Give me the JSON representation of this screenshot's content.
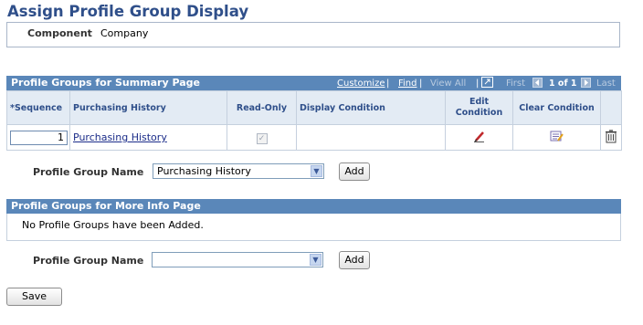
{
  "page": {
    "title": "Assign Profile Group Display"
  },
  "component": {
    "label": "Component",
    "value": "Company"
  },
  "summary_grid": {
    "title": "Profile Groups for Summary Page",
    "nav": {
      "customize": "Customize",
      "find": "Find",
      "view_all": "View All",
      "first": "First",
      "range": "1 of 1",
      "last": "Last",
      "sep": "|"
    },
    "columns": {
      "sequence": "*Sequence",
      "purchasing_history": "Purchasing History",
      "read_only": "Read-Only",
      "display_condition": "Display Condition",
      "edit_condition_1": "Edit",
      "edit_condition_2": "Condition",
      "clear_condition": "Clear Condition"
    },
    "rows": [
      {
        "sequence": "1",
        "purchasing_history": "Purchasing History",
        "read_only": true,
        "display_condition": ""
      }
    ]
  },
  "summary_add": {
    "label": "Profile Group Name",
    "selected": "Purchasing History",
    "add_label": "Add"
  },
  "more_info_grid": {
    "title": "Profile Groups for More Info Page",
    "empty_text": "No Profile Groups have been Added."
  },
  "more_info_add": {
    "label": "Profile Group Name",
    "selected": "",
    "add_label": "Add"
  },
  "footer": {
    "save_label": "Save"
  },
  "colors": {
    "title": "#2f4f8a",
    "grid_header": "#5a87b9",
    "column_header_bg": "#e3ebf4",
    "link": "#1b2c89"
  }
}
